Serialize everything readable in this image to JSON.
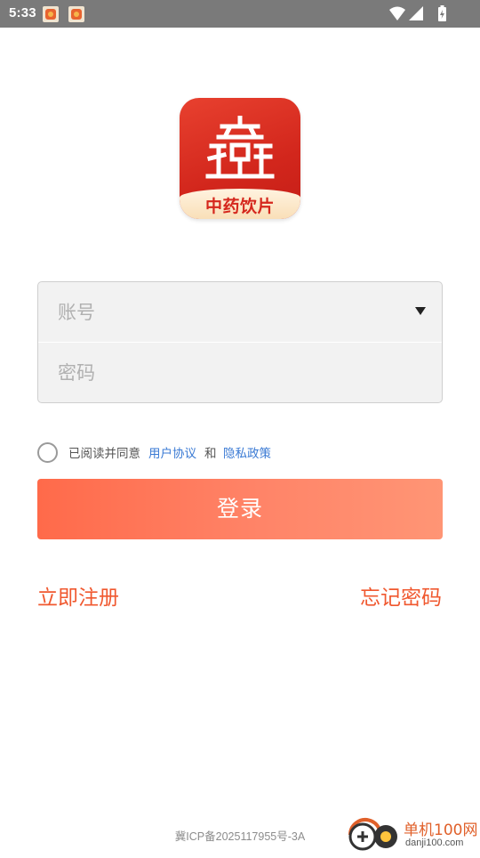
{
  "status_bar": {
    "time": "5:33",
    "icons": [
      "notification-app-icon",
      "notification-app-icon",
      "wifi-icon",
      "signal-icon",
      "battery-charging-icon"
    ]
  },
  "logo": {
    "banner_text": "中药饮片",
    "brand_color": "#d2261c"
  },
  "form": {
    "account_placeholder": "账号",
    "account_value": "",
    "password_placeholder": "密码",
    "password_value": ""
  },
  "agreement": {
    "prefix": "已阅读并同意",
    "user_agreement": "用户协议",
    "conjunction": "和",
    "privacy_policy": "隐私政策",
    "checked": false
  },
  "login_button": {
    "label": "登录"
  },
  "links": {
    "register": "立即注册",
    "forgot_password": "忘记密码"
  },
  "footer": {
    "icp": "冀ICP备2025117955号-3A"
  },
  "watermark": {
    "main": "单机100网",
    "sub": "danji100.com"
  },
  "colors": {
    "accent": "#f0582f",
    "link_blue": "#3a7ad4",
    "button_gradient_start": "#ff6a4a",
    "button_gradient_end": "#ff9575"
  }
}
